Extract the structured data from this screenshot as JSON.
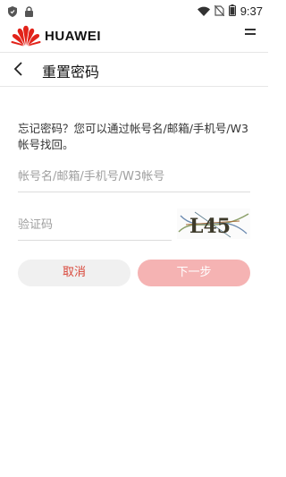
{
  "status_bar": {
    "left_icons": [
      "shield-icon",
      "lock-icon"
    ],
    "right_icons": [
      "wifi-icon",
      "no-sim-icon",
      "battery-icon"
    ],
    "time": "9:37"
  },
  "brand": {
    "name": "HUAWEI",
    "logo_color": "#e2231a",
    "menu_icon": "menu-icon"
  },
  "header": {
    "back_icon": "chevron-left-icon",
    "title": "重置密码"
  },
  "form": {
    "hint": "忘记密码？您可以通过帐号名/邮箱/手机号/W3帐号找回。",
    "account": {
      "placeholder": "帐号名/邮箱/手机号/W3帐号",
      "value": ""
    },
    "code": {
      "placeholder": "验证码",
      "value": ""
    },
    "captcha_text": "L45"
  },
  "buttons": {
    "cancel": "取消",
    "next": "下一步"
  },
  "colors": {
    "accent": "#d9473a",
    "next_disabled_bg": "#f5b3b3",
    "cancel_bg": "#f0f0f0"
  }
}
